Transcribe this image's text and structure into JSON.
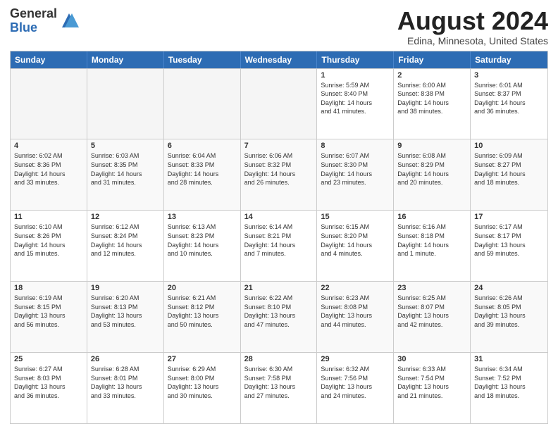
{
  "logo": {
    "general": "General",
    "blue": "Blue"
  },
  "title": "August 2024",
  "location": "Edina, Minnesota, United States",
  "days_of_week": [
    "Sunday",
    "Monday",
    "Tuesday",
    "Wednesday",
    "Thursday",
    "Friday",
    "Saturday"
  ],
  "weeks": [
    [
      {
        "day": "",
        "info": "",
        "empty": true
      },
      {
        "day": "",
        "info": "",
        "empty": true
      },
      {
        "day": "",
        "info": "",
        "empty": true
      },
      {
        "day": "",
        "info": "",
        "empty": true
      },
      {
        "day": "1",
        "info": "Sunrise: 5:59 AM\nSunset: 8:40 PM\nDaylight: 14 hours\nand 41 minutes."
      },
      {
        "day": "2",
        "info": "Sunrise: 6:00 AM\nSunset: 8:38 PM\nDaylight: 14 hours\nand 38 minutes."
      },
      {
        "day": "3",
        "info": "Sunrise: 6:01 AM\nSunset: 8:37 PM\nDaylight: 14 hours\nand 36 minutes."
      }
    ],
    [
      {
        "day": "4",
        "info": "Sunrise: 6:02 AM\nSunset: 8:36 PM\nDaylight: 14 hours\nand 33 minutes."
      },
      {
        "day": "5",
        "info": "Sunrise: 6:03 AM\nSunset: 8:35 PM\nDaylight: 14 hours\nand 31 minutes."
      },
      {
        "day": "6",
        "info": "Sunrise: 6:04 AM\nSunset: 8:33 PM\nDaylight: 14 hours\nand 28 minutes."
      },
      {
        "day": "7",
        "info": "Sunrise: 6:06 AM\nSunset: 8:32 PM\nDaylight: 14 hours\nand 26 minutes."
      },
      {
        "day": "8",
        "info": "Sunrise: 6:07 AM\nSunset: 8:30 PM\nDaylight: 14 hours\nand 23 minutes."
      },
      {
        "day": "9",
        "info": "Sunrise: 6:08 AM\nSunset: 8:29 PM\nDaylight: 14 hours\nand 20 minutes."
      },
      {
        "day": "10",
        "info": "Sunrise: 6:09 AM\nSunset: 8:27 PM\nDaylight: 14 hours\nand 18 minutes."
      }
    ],
    [
      {
        "day": "11",
        "info": "Sunrise: 6:10 AM\nSunset: 8:26 PM\nDaylight: 14 hours\nand 15 minutes."
      },
      {
        "day": "12",
        "info": "Sunrise: 6:12 AM\nSunset: 8:24 PM\nDaylight: 14 hours\nand 12 minutes."
      },
      {
        "day": "13",
        "info": "Sunrise: 6:13 AM\nSunset: 8:23 PM\nDaylight: 14 hours\nand 10 minutes."
      },
      {
        "day": "14",
        "info": "Sunrise: 6:14 AM\nSunset: 8:21 PM\nDaylight: 14 hours\nand 7 minutes."
      },
      {
        "day": "15",
        "info": "Sunrise: 6:15 AM\nSunset: 8:20 PM\nDaylight: 14 hours\nand 4 minutes."
      },
      {
        "day": "16",
        "info": "Sunrise: 6:16 AM\nSunset: 8:18 PM\nDaylight: 14 hours\nand 1 minute."
      },
      {
        "day": "17",
        "info": "Sunrise: 6:17 AM\nSunset: 8:17 PM\nDaylight: 13 hours\nand 59 minutes."
      }
    ],
    [
      {
        "day": "18",
        "info": "Sunrise: 6:19 AM\nSunset: 8:15 PM\nDaylight: 13 hours\nand 56 minutes."
      },
      {
        "day": "19",
        "info": "Sunrise: 6:20 AM\nSunset: 8:13 PM\nDaylight: 13 hours\nand 53 minutes."
      },
      {
        "day": "20",
        "info": "Sunrise: 6:21 AM\nSunset: 8:12 PM\nDaylight: 13 hours\nand 50 minutes."
      },
      {
        "day": "21",
        "info": "Sunrise: 6:22 AM\nSunset: 8:10 PM\nDaylight: 13 hours\nand 47 minutes."
      },
      {
        "day": "22",
        "info": "Sunrise: 6:23 AM\nSunset: 8:08 PM\nDaylight: 13 hours\nand 44 minutes."
      },
      {
        "day": "23",
        "info": "Sunrise: 6:25 AM\nSunset: 8:07 PM\nDaylight: 13 hours\nand 42 minutes."
      },
      {
        "day": "24",
        "info": "Sunrise: 6:26 AM\nSunset: 8:05 PM\nDaylight: 13 hours\nand 39 minutes."
      }
    ],
    [
      {
        "day": "25",
        "info": "Sunrise: 6:27 AM\nSunset: 8:03 PM\nDaylight: 13 hours\nand 36 minutes."
      },
      {
        "day": "26",
        "info": "Sunrise: 6:28 AM\nSunset: 8:01 PM\nDaylight: 13 hours\nand 33 minutes."
      },
      {
        "day": "27",
        "info": "Sunrise: 6:29 AM\nSunset: 8:00 PM\nDaylight: 13 hours\nand 30 minutes."
      },
      {
        "day": "28",
        "info": "Sunrise: 6:30 AM\nSunset: 7:58 PM\nDaylight: 13 hours\nand 27 minutes."
      },
      {
        "day": "29",
        "info": "Sunrise: 6:32 AM\nSunset: 7:56 PM\nDaylight: 13 hours\nand 24 minutes."
      },
      {
        "day": "30",
        "info": "Sunrise: 6:33 AM\nSunset: 7:54 PM\nDaylight: 13 hours\nand 21 minutes."
      },
      {
        "day": "31",
        "info": "Sunrise: 6:34 AM\nSunset: 7:52 PM\nDaylight: 13 hours\nand 18 minutes."
      }
    ]
  ]
}
